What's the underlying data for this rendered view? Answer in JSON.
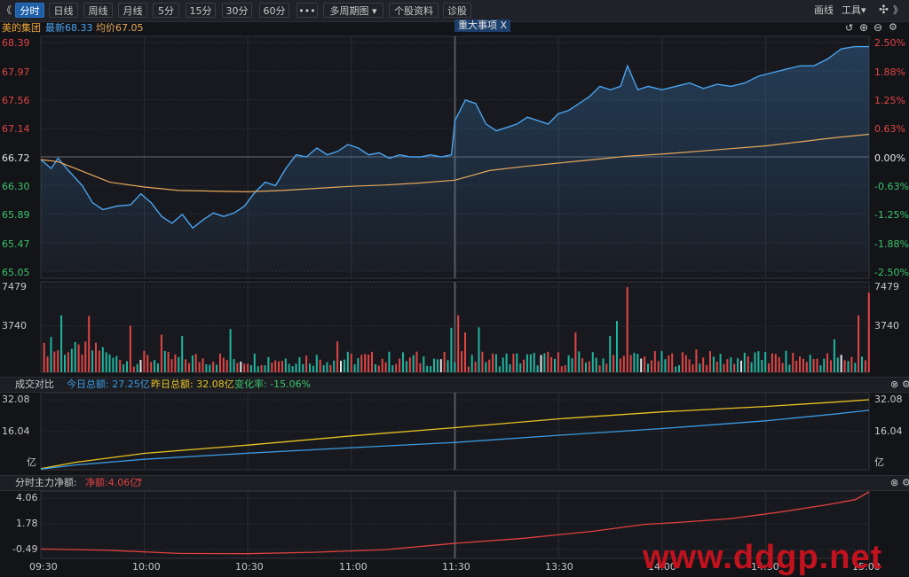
{
  "toolbar": {
    "nav_left": "《",
    "tabs": [
      "分时",
      "日线",
      "周线",
      "月线",
      "5分",
      "15分",
      "30分",
      "60分"
    ],
    "more": "•••",
    "multi_period": "多周期图",
    "stock_info": "个股资料",
    "diagnose": "诊股",
    "draw_line": "画线",
    "tools": "工具",
    "nav_right": "》"
  },
  "info": {
    "stock_name": "美的集团",
    "latest": "最新68.33",
    "average": "均价67.05",
    "event_tag": "重大事项  X"
  },
  "price_panel": {
    "left_axis": [
      "68.39",
      "67.97",
      "67.56",
      "67.14",
      "66.72",
      "66.30",
      "65.89",
      "65.47",
      "65.05"
    ],
    "right_axis": [
      "2.50%",
      "1.88%",
      "1.25%",
      "0.63%",
      "0.00%",
      "-0.63%",
      "-1.25%",
      "-1.88%",
      "-2.50%"
    ]
  },
  "volume_panel": {
    "left_axis": [
      "7479",
      "3740"
    ],
    "right_axis": [
      "7479",
      "3740"
    ]
  },
  "turnover_panel": {
    "title": "成交对比",
    "today": "今日总额: 27.25亿",
    "yesterday": "昨日总额: 32.08亿",
    "change": "变化率: -15.06%",
    "left_axis": [
      "32.08",
      "16.04",
      "亿"
    ],
    "right_axis": [
      "32.08",
      "16.04",
      "亿"
    ]
  },
  "mainforce_panel": {
    "title": "分时主力净额:",
    "net": "净额:4.06亿",
    "arrow": "↑",
    "left_axis": [
      "4.06",
      "1.78",
      "-0.49"
    ]
  },
  "x_axis": [
    "09:30",
    "10:00",
    "10:30",
    "11:00",
    "11:30",
    "13:30",
    "14:00",
    "14:30",
    "15:00"
  ],
  "watermark": "www.ddgp.net",
  "colors": {
    "price_line": "#4aa3ef",
    "avg_line": "#e6a85c",
    "up": "#e04545",
    "down": "#1fb5a0",
    "today_line": "#3b9ae1",
    "yesterday_line": "#e8c323",
    "mainforce_line": "#e04040"
  },
  "chart_data": [
    {
      "type": "line",
      "title": "美的集团",
      "x": [
        "09:30",
        "10:00",
        "10:30",
        "11:00",
        "11:30",
        "13:30",
        "14:00",
        "14:30",
        "15:00"
      ],
      "ylim": [
        65.05,
        68.39
      ],
      "prev_close": 66.72,
      "series": [
        {
          "name": "最新",
          "points": [
            [
              0,
              66.68
            ],
            [
              3,
              66.55
            ],
            [
              5,
              66.7
            ],
            [
              8,
              66.52
            ],
            [
              12,
              66.3
            ],
            [
              15,
              66.05
            ],
            [
              18,
              65.95
            ],
            [
              22,
              66.0
            ],
            [
              26,
              66.02
            ],
            [
              29,
              66.18
            ],
            [
              32,
              66.05
            ],
            [
              35,
              65.85
            ],
            [
              38,
              65.75
            ],
            [
              41,
              65.88
            ],
            [
              44,
              65.68
            ],
            [
              47,
              65.8
            ],
            [
              50,
              65.9
            ],
            [
              53,
              65.85
            ],
            [
              56,
              65.9
            ],
            [
              59,
              66.0
            ],
            [
              62,
              66.2
            ],
            [
              65,
              66.35
            ],
            [
              68,
              66.3
            ],
            [
              71,
              66.55
            ],
            [
              74,
              66.75
            ],
            [
              77,
              66.72
            ],
            [
              80,
              66.85
            ],
            [
              83,
              66.75
            ],
            [
              86,
              66.8
            ],
            [
              89,
              66.9
            ],
            [
              92,
              66.85
            ],
            [
              95,
              66.75
            ],
            [
              98,
              66.78
            ],
            [
              101,
              66.7
            ],
            [
              104,
              66.75
            ],
            [
              107,
              66.72
            ],
            [
              110,
              66.72
            ],
            [
              113,
              66.75
            ],
            [
              116,
              66.72
            ],
            [
              119,
              66.75
            ],
            [
              120,
              67.25
            ],
            [
              123,
              67.55
            ],
            [
              126,
              67.5
            ],
            [
              129,
              67.2
            ],
            [
              132,
              67.1
            ],
            [
              135,
              67.15
            ],
            [
              138,
              67.2
            ],
            [
              141,
              67.3
            ],
            [
              144,
              67.25
            ],
            [
              147,
              67.2
            ],
            [
              150,
              67.35
            ],
            [
              153,
              67.4
            ],
            [
              156,
              67.5
            ],
            [
              159,
              67.6
            ],
            [
              162,
              67.75
            ],
            [
              165,
              67.7
            ],
            [
              168,
              67.75
            ],
            [
              170,
              68.05
            ],
            [
              173,
              67.7
            ],
            [
              176,
              67.75
            ],
            [
              180,
              67.7
            ],
            [
              184,
              67.75
            ],
            [
              188,
              67.8
            ],
            [
              192,
              67.72
            ],
            [
              196,
              67.78
            ],
            [
              200,
              67.75
            ],
            [
              204,
              67.8
            ],
            [
              208,
              67.9
            ],
            [
              212,
              67.95
            ],
            [
              216,
              68.0
            ],
            [
              220,
              68.05
            ],
            [
              224,
              68.05
            ],
            [
              228,
              68.15
            ],
            [
              232,
              68.3
            ],
            [
              236,
              68.33
            ],
            [
              240,
              68.33
            ]
          ]
        },
        {
          "name": "均价",
          "points": [
            [
              0,
              66.68
            ],
            [
              5,
              66.65
            ],
            [
              10,
              66.55
            ],
            [
              20,
              66.35
            ],
            [
              30,
              66.28
            ],
            [
              40,
              66.23
            ],
            [
              50,
              66.22
            ],
            [
              60,
              66.21
            ],
            [
              70,
              66.23
            ],
            [
              80,
              66.26
            ],
            [
              90,
              66.29
            ],
            [
              100,
              66.31
            ],
            [
              110,
              66.34
            ],
            [
              120,
              66.38
            ],
            [
              130,
              66.52
            ],
            [
              140,
              66.58
            ],
            [
              150,
              66.63
            ],
            [
              160,
              66.68
            ],
            [
              170,
              66.73
            ],
            [
              180,
              66.76
            ],
            [
              190,
              66.8
            ],
            [
              200,
              66.84
            ],
            [
              210,
              66.88
            ],
            [
              220,
              66.94
            ],
            [
              230,
              67.0
            ],
            [
              240,
              67.05
            ]
          ]
        }
      ]
    },
    {
      "type": "bar",
      "title": "成交量",
      "ylim": [
        0,
        7479
      ],
      "x_range": [
        0,
        240
      ],
      "volume_peaks": [
        [
          3,
          3100
        ],
        [
          6,
          5000
        ],
        [
          14,
          4950
        ],
        [
          26,
          4100
        ],
        [
          35,
          3300
        ],
        [
          41,
          3200
        ],
        [
          55,
          3800
        ],
        [
          86,
          2700
        ],
        [
          119,
          3900
        ],
        [
          121,
          5000
        ],
        [
          123,
          3500
        ],
        [
          127,
          3950
        ],
        [
          155,
          3500
        ],
        [
          165,
          3200
        ],
        [
          167,
          4500
        ],
        [
          170,
          7479
        ],
        [
          190,
          2000
        ],
        [
          210,
          1800
        ],
        [
          230,
          2900
        ],
        [
          237,
          5000
        ],
        [
          240,
          7000
        ]
      ]
    },
    {
      "type": "line",
      "title": "成交对比",
      "ylim": [
        0,
        32.08
      ],
      "series": [
        {
          "name": "今日总额",
          "points": [
            [
              0,
              0.3
            ],
            [
              10,
              2.2
            ],
            [
              30,
              4.8
            ],
            [
              60,
              7.6
            ],
            [
              90,
              10.1
            ],
            [
              120,
              12.5
            ],
            [
              150,
              15.8
            ],
            [
              180,
              18.9
            ],
            [
              210,
              22.4
            ],
            [
              230,
              25.5
            ],
            [
              240,
              27.25
            ]
          ]
        },
        {
          "name": "昨日总额",
          "points": [
            [
              0,
              0.5
            ],
            [
              10,
              3.4
            ],
            [
              30,
              7.5
            ],
            [
              60,
              11.3
            ],
            [
              90,
              15.5
            ],
            [
              120,
              19.3
            ],
            [
              150,
              23.3
            ],
            [
              180,
              26.5
            ],
            [
              210,
              29.0
            ],
            [
              230,
              31.0
            ],
            [
              240,
              32.08
            ]
          ]
        }
      ]
    },
    {
      "type": "line",
      "title": "分时主力净额",
      "ylim": [
        -0.49,
        4.06
      ],
      "series": [
        {
          "name": "净额",
          "points": [
            [
              0,
              -0.45
            ],
            [
              20,
              -0.55
            ],
            [
              40,
              -0.8
            ],
            [
              60,
              -0.82
            ],
            [
              80,
              -0.7
            ],
            [
              100,
              -0.5
            ],
            [
              120,
              0.0
            ],
            [
              140,
              0.4
            ],
            [
              160,
              0.95
            ],
            [
              175,
              1.5
            ],
            [
              185,
              1.65
            ],
            [
              200,
              1.95
            ],
            [
              215,
              2.5
            ],
            [
              228,
              3.05
            ],
            [
              236,
              3.45
            ],
            [
              240,
              4.06
            ]
          ]
        }
      ]
    }
  ]
}
